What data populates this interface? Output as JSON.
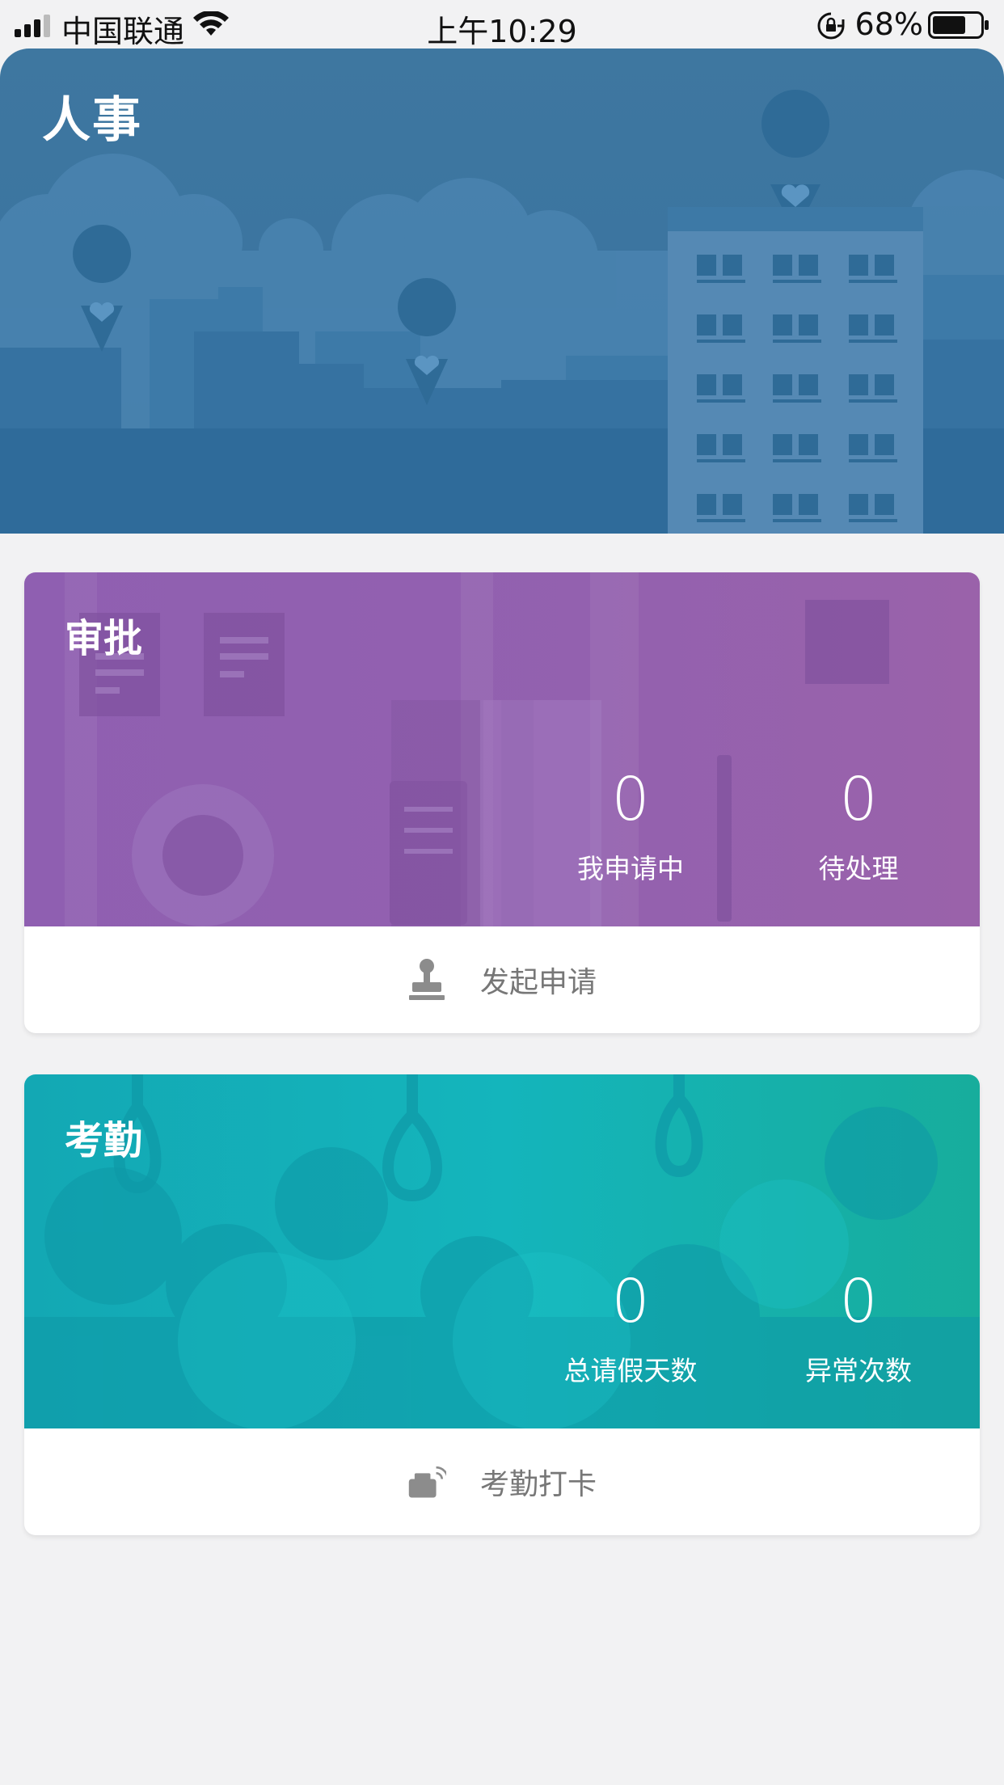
{
  "status_bar": {
    "carrier": "中国联通",
    "time": "上午10:29",
    "battery": "68%"
  },
  "header": {
    "title": "人事"
  },
  "approval": {
    "title": "审批",
    "stats": [
      {
        "value": "0",
        "label": "我申请中"
      },
      {
        "value": "0",
        "label": "待处理"
      }
    ],
    "action_label": "发起申请",
    "action_icon": "stamp-icon",
    "color": "#9361af"
  },
  "attendance": {
    "title": "考勤",
    "stats": [
      {
        "value": "0",
        "label": "总请假天数"
      },
      {
        "value": "0",
        "label": "异常次数"
      }
    ],
    "action_label": "考勤打卡",
    "action_icon": "card-reader-icon",
    "color": "#14b5bc"
  }
}
